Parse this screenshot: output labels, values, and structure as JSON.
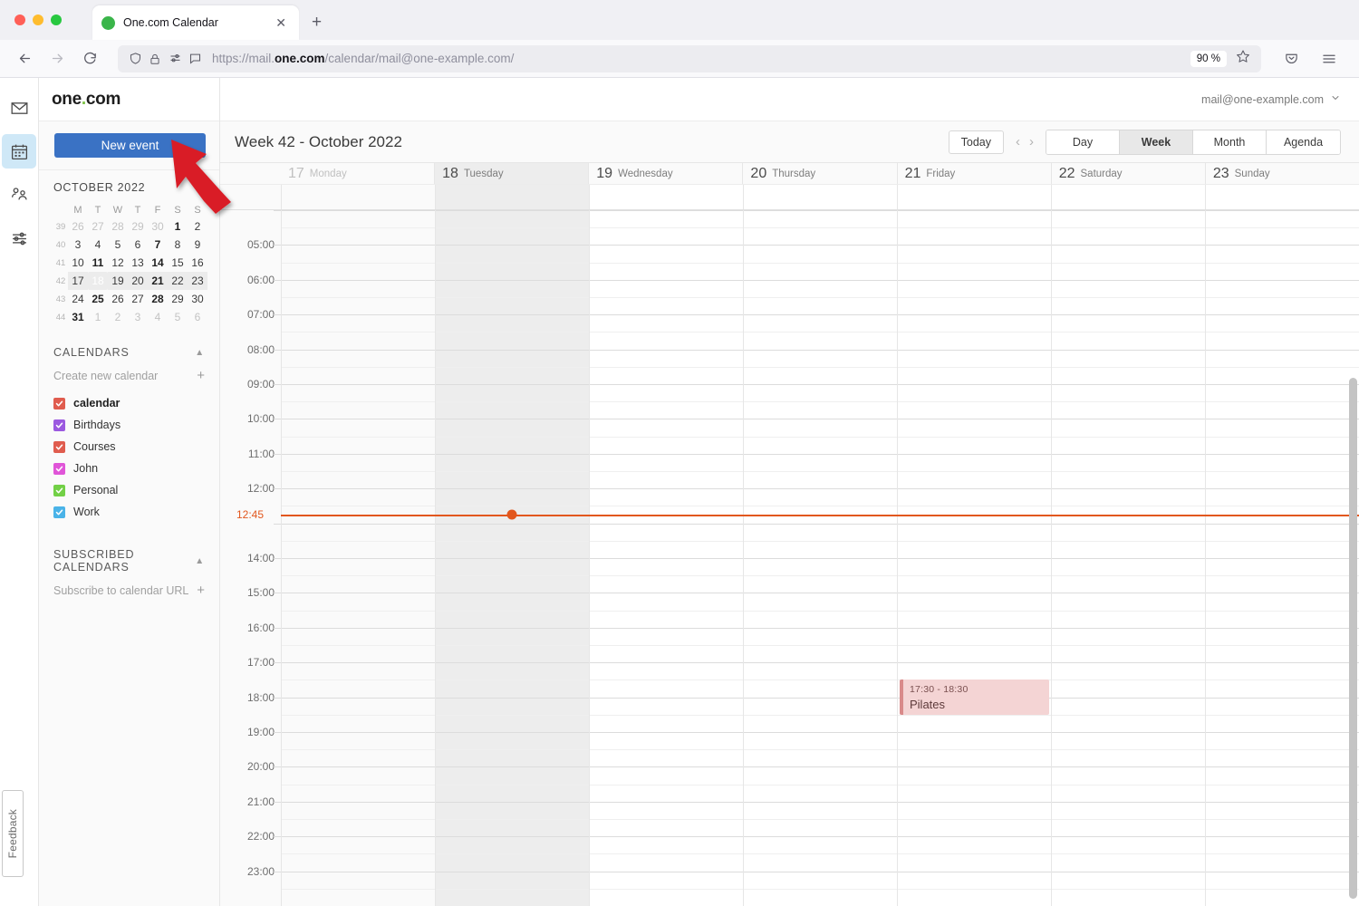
{
  "browser": {
    "tab": {
      "title": "One.com Calendar",
      "favicon_color": "#3ab54a",
      "close_label": "✕"
    },
    "new_tab_label": "+",
    "nav": {
      "back": "←",
      "forward": "→",
      "reload": "↻"
    },
    "url": {
      "scheme": "https://mail.",
      "domain": "one.com",
      "path": "/calendar/mail@one-example.com/"
    },
    "zoom_level": "90 %",
    "icons": [
      "shield-icon",
      "lock-icon",
      "permissions-icon",
      "reader-icon",
      "bookmark-star-icon",
      "pocket-icon",
      "menu-icon"
    ]
  },
  "rail": {
    "items": [
      {
        "name": "mail",
        "icon": "envelope-icon",
        "active": false
      },
      {
        "name": "calendar",
        "icon": "calendar-icon",
        "active": true
      },
      {
        "name": "contacts",
        "icon": "contacts-icon",
        "active": false
      },
      {
        "name": "settings",
        "icon": "sliders-icon",
        "active": false
      }
    ],
    "feedback_label": "Feedback"
  },
  "brand": {
    "text_before": "one",
    "dot": ".",
    "text_after": "com"
  },
  "account": {
    "email": "mail@one-example.com",
    "chevron": "⌄"
  },
  "sidebar": {
    "new_event_label": "New event",
    "minical": {
      "title": "OCTOBER 2022",
      "collapse_icon": "chevron-up-icon",
      "weekday_headers": [
        "M",
        "T",
        "W",
        "T",
        "F",
        "S",
        "S"
      ],
      "weeks": [
        {
          "wk": "39",
          "days": [
            {
              "d": "26",
              "muted": true
            },
            {
              "d": "27",
              "muted": true
            },
            {
              "d": "28",
              "muted": true
            },
            {
              "d": "29",
              "muted": true
            },
            {
              "d": "30",
              "muted": true
            },
            {
              "d": "1",
              "bold": true
            },
            {
              "d": "2"
            }
          ]
        },
        {
          "wk": "40",
          "days": [
            {
              "d": "3"
            },
            {
              "d": "4"
            },
            {
              "d": "5"
            },
            {
              "d": "6"
            },
            {
              "d": "7",
              "bold": true
            },
            {
              "d": "8"
            },
            {
              "d": "9"
            }
          ]
        },
        {
          "wk": "41",
          "days": [
            {
              "d": "10"
            },
            {
              "d": "11",
              "bold": true
            },
            {
              "d": "12"
            },
            {
              "d": "13"
            },
            {
              "d": "14",
              "bold": true
            },
            {
              "d": "15"
            },
            {
              "d": "16"
            }
          ]
        },
        {
          "wk": "42",
          "selected": true,
          "days": [
            {
              "d": "17"
            },
            {
              "d": "18",
              "today": true
            },
            {
              "d": "19"
            },
            {
              "d": "20"
            },
            {
              "d": "21",
              "bold": true
            },
            {
              "d": "22"
            },
            {
              "d": "23"
            }
          ]
        },
        {
          "wk": "43",
          "days": [
            {
              "d": "24"
            },
            {
              "d": "25",
              "bold": true
            },
            {
              "d": "26"
            },
            {
              "d": "27"
            },
            {
              "d": "28",
              "bold": true
            },
            {
              "d": "29"
            },
            {
              "d": "30"
            }
          ]
        },
        {
          "wk": "44",
          "days": [
            {
              "d": "31",
              "bold": true
            },
            {
              "d": "1",
              "muted": true
            },
            {
              "d": "2",
              "muted": true
            },
            {
              "d": "3",
              "muted": true
            },
            {
              "d": "4",
              "muted": true
            },
            {
              "d": "5",
              "muted": true
            },
            {
              "d": "6",
              "muted": true
            }
          ]
        }
      ]
    },
    "calendars_section": {
      "title": "CALENDARS",
      "create_label": "Create new calendar",
      "plus": "+",
      "items": [
        {
          "label": "calendar",
          "color": "#e05c4e",
          "checked": true,
          "bold": true
        },
        {
          "label": "Birthdays",
          "color": "#9b59e0",
          "checked": true,
          "bold": false
        },
        {
          "label": "Courses",
          "color": "#e05c4e",
          "checked": true,
          "bold": false
        },
        {
          "label": "John",
          "color": "#e055d8",
          "checked": true,
          "bold": false
        },
        {
          "label": "Personal",
          "color": "#72d046",
          "checked": true,
          "bold": false
        },
        {
          "label": "Work",
          "color": "#4ab3e8",
          "checked": true,
          "bold": false
        }
      ]
    },
    "subscribed_section": {
      "title": "SUBSCRIBED CALENDARS",
      "subscribe_label": "Subscribe to calendar URL",
      "plus": "+"
    }
  },
  "calendar": {
    "period_title": "Week 42 - October 2022",
    "today_label": "Today",
    "prev_label": "‹",
    "next_label": "›",
    "views": [
      {
        "label": "Day",
        "selected": false
      },
      {
        "label": "Week",
        "selected": true
      },
      {
        "label": "Month",
        "selected": false
      },
      {
        "label": "Agenda",
        "selected": false
      }
    ],
    "days": [
      {
        "num": "17",
        "name": "Monday",
        "past": true,
        "today": false
      },
      {
        "num": "18",
        "name": "Tuesday",
        "past": false,
        "today": true
      },
      {
        "num": "19",
        "name": "Wednesday",
        "past": false,
        "today": false
      },
      {
        "num": "20",
        "name": "Thursday",
        "past": false,
        "today": false
      },
      {
        "num": "21",
        "name": "Friday",
        "past": false,
        "today": false
      },
      {
        "num": "22",
        "name": "Saturday",
        "past": false,
        "today": false
      },
      {
        "num": "23",
        "name": "Sunday",
        "past": false,
        "today": false
      }
    ],
    "hours": [
      "05:00",
      "06:00",
      "07:00",
      "08:00",
      "09:00",
      "10:00",
      "11:00",
      "12:00",
      "14:00",
      "15:00",
      "16:00",
      "17:00",
      "18:00",
      "19:00",
      "20:00",
      "21:00",
      "22:00",
      "23:00"
    ],
    "hour_start": 4,
    "hour_end": 24,
    "now": {
      "label": "12:45",
      "hour_decimal": 12.75,
      "color": "#e2571e",
      "day_index": 1
    },
    "events": [
      {
        "title": "Pilates",
        "time_label": "17:30 - 18:30",
        "day_index": 4,
        "start_hour": 17.5,
        "end_hour": 18.5,
        "bg": "#f4d4d4",
        "accent": "#d98a8a"
      }
    ]
  }
}
